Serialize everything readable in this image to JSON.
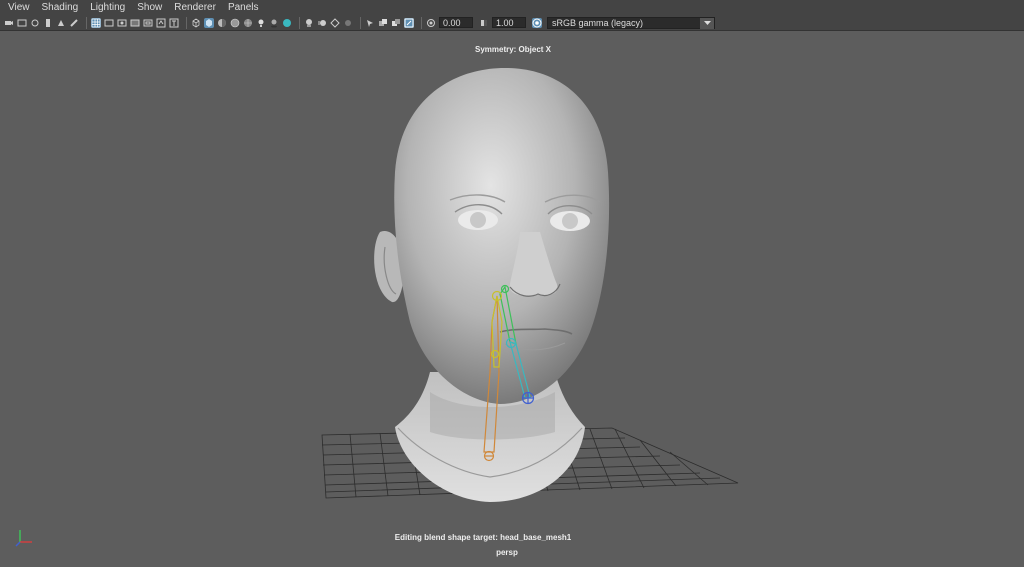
{
  "menu": {
    "items": [
      "View",
      "Shading",
      "Lighting",
      "Show",
      "Renderer",
      "Panels"
    ]
  },
  "toolbar": {
    "exposure_value": "0.00",
    "gamma_value": "1.00",
    "color_space": "sRGB gamma (legacy)"
  },
  "viewport": {
    "symmetry_label": "Symmetry: Object X",
    "editing_label": "Editing blend shape target: head_base_mesh1",
    "camera_label": "persp"
  },
  "colors": {
    "bg": "#5d5d5d",
    "toolbar": "#444444",
    "active_icon": "#5e8fb3",
    "joint_orange": "#d0883a",
    "joint_yellow": "#c7c02c",
    "joint_green": "#3ec05a",
    "joint_cyan": "#3ab8c0",
    "joint_blue": "#4060d0"
  }
}
